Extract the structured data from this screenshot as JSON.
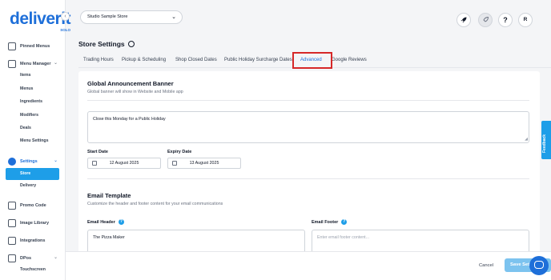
{
  "brand": {
    "name": "deliverit",
    "sub": "SOLO",
    "accent": "#1e6fd9"
  },
  "sidebar": {
    "pinned": "Pinned Menus",
    "menu_manager": "Menu Manager",
    "menu_items": [
      "Items",
      "Menus",
      "Ingredients",
      "Modifiers",
      "Deals",
      "Menu Settings"
    ],
    "settings": "Settings",
    "settings_items": [
      "Store",
      "Delivery"
    ],
    "promo": "Promo Code",
    "image_library": "Image Library",
    "integrations": "Integrations",
    "dpos": "DPos",
    "dpos_items": [
      "Touchscreen"
    ]
  },
  "topbar": {
    "store_select": "Studio Sample Store",
    "icons": [
      "rocket-icon",
      "rocket-outline-icon",
      "help-icon",
      "user-avatar"
    ],
    "help_glyph": "?",
    "avatar_initial": "R"
  },
  "page": {
    "title": "Store Settings",
    "tabs": [
      "Trading Hours",
      "Pickup & Scheduling",
      "Shop Closed Dates",
      "Public Holiday Surcharge Dates",
      "Advanced",
      "Google Reviews"
    ],
    "active_tab": "Advanced"
  },
  "announcement": {
    "title": "Global Announcement Banner",
    "desc": "Global banner will show in Website and Mobile app",
    "message": "Close this Monday for a Public Holiday",
    "start_label": "Start Date",
    "start_value": "12 August 2025",
    "expiry_label": "Expiry Date",
    "expiry_value": "13 August 2025"
  },
  "email": {
    "title": "Email Template",
    "desc": "Customize the header and footer content for your email communications",
    "header_label": "Email Header",
    "header_value": "The Pizza Maker",
    "footer_label": "Email Footer",
    "footer_placeholder": "Enter email footer content..."
  },
  "footer": {
    "cancel": "Cancel",
    "save": "Save Settings"
  },
  "feedback": "Feedback"
}
